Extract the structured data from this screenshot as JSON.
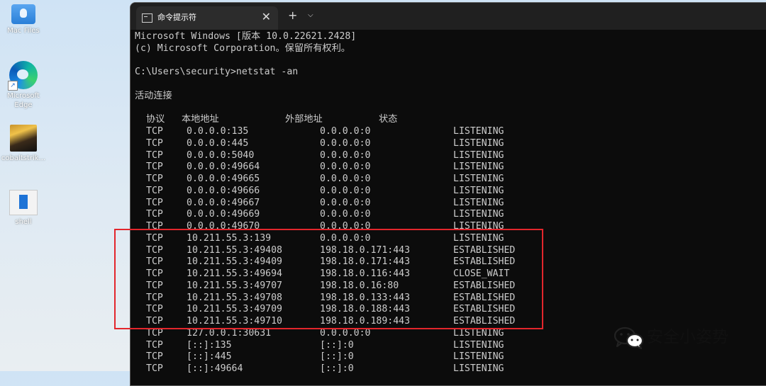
{
  "desktop": {
    "icons": [
      {
        "label": "Mac Files",
        "icon": "folder-icon"
      },
      {
        "label": "Microsoft Edge",
        "icon": "edge-icon"
      },
      {
        "label": "cobaltstrik...",
        "icon": "app-icon"
      },
      {
        "label": "shell",
        "icon": "file-icon"
      }
    ]
  },
  "window": {
    "tab_title": "命令提示符",
    "close_glyph": "✕",
    "new_tab_glyph": "+",
    "dropdown_glyph": "⌵"
  },
  "terminal": {
    "header_lines": [
      "Microsoft Windows [版本 10.0.22621.2428]",
      "(c) Microsoft Corporation。保留所有权利。",
      "",
      "C:\\Users\\security>netstat -an",
      "",
      "活动连接",
      ""
    ],
    "column_headers": {
      "proto": "协议",
      "local": "本地地址",
      "foreign": "外部地址",
      "state": "状态"
    },
    "rows": [
      {
        "proto": "TCP",
        "local": "0.0.0.0:135",
        "foreign": "0.0.0.0:0",
        "state": "LISTENING"
      },
      {
        "proto": "TCP",
        "local": "0.0.0.0:445",
        "foreign": "0.0.0.0:0",
        "state": "LISTENING"
      },
      {
        "proto": "TCP",
        "local": "0.0.0.0:5040",
        "foreign": "0.0.0.0:0",
        "state": "LISTENING"
      },
      {
        "proto": "TCP",
        "local": "0.0.0.0:49664",
        "foreign": "0.0.0.0:0",
        "state": "LISTENING"
      },
      {
        "proto": "TCP",
        "local": "0.0.0.0:49665",
        "foreign": "0.0.0.0:0",
        "state": "LISTENING"
      },
      {
        "proto": "TCP",
        "local": "0.0.0.0:49666",
        "foreign": "0.0.0.0:0",
        "state": "LISTENING"
      },
      {
        "proto": "TCP",
        "local": "0.0.0.0:49667",
        "foreign": "0.0.0.0:0",
        "state": "LISTENING"
      },
      {
        "proto": "TCP",
        "local": "0.0.0.0:49669",
        "foreign": "0.0.0.0:0",
        "state": "LISTENING"
      },
      {
        "proto": "TCP",
        "local": "0.0.0.0:49670",
        "foreign": "0.0.0.0:0",
        "state": "LISTENING"
      },
      {
        "proto": "TCP",
        "local": "10.211.55.3:139",
        "foreign": "0.0.0.0:0",
        "state": "LISTENING"
      },
      {
        "proto": "TCP",
        "local": "10.211.55.3:49408",
        "foreign": "198.18.0.171:443",
        "state": "ESTABLISHED"
      },
      {
        "proto": "TCP",
        "local": "10.211.55.3:49409",
        "foreign": "198.18.0.171:443",
        "state": "ESTABLISHED"
      },
      {
        "proto": "TCP",
        "local": "10.211.55.3:49694",
        "foreign": "198.18.0.116:443",
        "state": "CLOSE_WAIT"
      },
      {
        "proto": "TCP",
        "local": "10.211.55.3:49707",
        "foreign": "198.18.0.16:80",
        "state": "ESTABLISHED"
      },
      {
        "proto": "TCP",
        "local": "10.211.55.3:49708",
        "foreign": "198.18.0.133:443",
        "state": "ESTABLISHED"
      },
      {
        "proto": "TCP",
        "local": "10.211.55.3:49709",
        "foreign": "198.18.0.188:443",
        "state": "ESTABLISHED"
      },
      {
        "proto": "TCP",
        "local": "10.211.55.3:49710",
        "foreign": "198.18.0.189:443",
        "state": "ESTABLISHED"
      },
      {
        "proto": "TCP",
        "local": "127.0.0.1:30631",
        "foreign": "0.0.0.0:0",
        "state": "LISTENING"
      },
      {
        "proto": "TCP",
        "local": "[::]:135",
        "foreign": "[::]:0",
        "state": "LISTENING"
      },
      {
        "proto": "TCP",
        "local": "[::]:445",
        "foreign": "[::]:0",
        "state": "LISTENING"
      },
      {
        "proto": "TCP",
        "local": "[::]:49664",
        "foreign": "[::]:0",
        "state": "LISTENING"
      }
    ]
  },
  "annotation": {
    "color": "#e3262c"
  },
  "watermark": {
    "text": "安全小姿势",
    "icon": "wechat-icon"
  }
}
